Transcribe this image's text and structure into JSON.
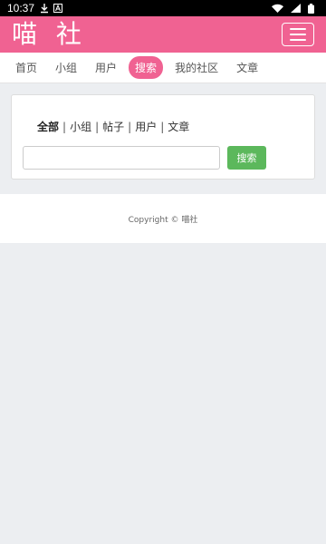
{
  "status_bar": {
    "time": "10:37",
    "left_icons": [
      "download-icon",
      "notification-a-icon"
    ],
    "right_icons": [
      "wifi-icon",
      "signal-icon",
      "battery-icon"
    ]
  },
  "header": {
    "brand": "喵 社",
    "menu_icon": "hamburger-menu-icon",
    "brand_color": "#f06292"
  },
  "nav": {
    "tabs": [
      {
        "label": "首页",
        "active": false
      },
      {
        "label": "小组",
        "active": false
      },
      {
        "label": "用户",
        "active": false
      },
      {
        "label": "搜索",
        "active": true
      },
      {
        "label": "我的社区",
        "active": false
      },
      {
        "label": "文章",
        "active": false
      }
    ]
  },
  "search": {
    "filters": [
      "全部",
      "小组",
      "帖子",
      "用户",
      "文章"
    ],
    "active_filter": "全部",
    "separator": "|",
    "input_value": "",
    "input_placeholder": "",
    "button_label": "搜索",
    "button_color": "#5cb85c"
  },
  "footer": {
    "copyright": "Copyright © 喵社"
  }
}
